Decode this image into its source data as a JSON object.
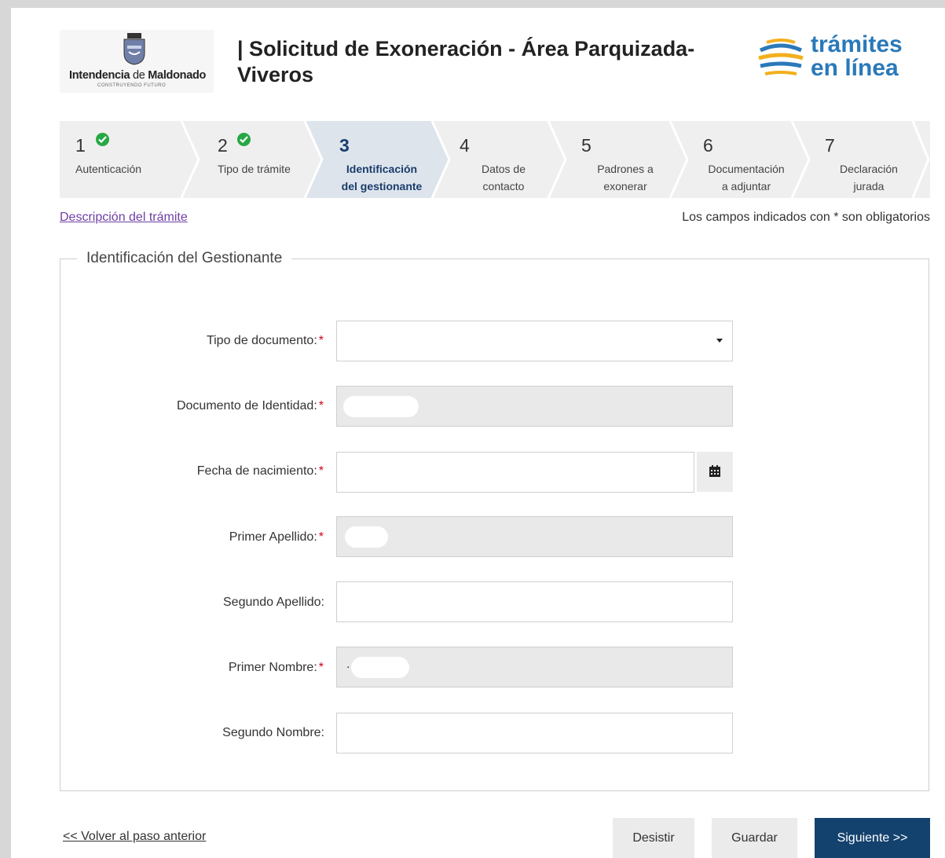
{
  "header": {
    "org_name_bold": "Intendencia",
    "org_name_de": "de",
    "org_name_place": "Maldonado",
    "org_motto": "CONSTRUYENDO FUTURO",
    "title": "| Solicitud de Exoneración - Área Parquizada- Viveros",
    "brand_line1": "trámites",
    "brand_line2": "en línea"
  },
  "stepper": {
    "steps": [
      {
        "number": "1",
        "label": "Autenticación",
        "state": "completed"
      },
      {
        "number": "2",
        "label": "Tipo de trámite",
        "state": "completed"
      },
      {
        "number": "3",
        "label_line1": "Identificación",
        "label_line2": "del gestionante",
        "state": "active"
      },
      {
        "number": "4",
        "label_line1": "Datos de",
        "label_line2": "contacto",
        "state": "pending"
      },
      {
        "number": "5",
        "label_line1": "Padrones a",
        "label_line2": "exonerar",
        "state": "pending"
      },
      {
        "number": "6",
        "label_line1": "Documentación",
        "label_line2": "a adjuntar",
        "state": "pending"
      },
      {
        "number": "7",
        "label_line1": "Declaración",
        "label_line2": "jurada",
        "state": "pending"
      }
    ]
  },
  "links": {
    "description": "Descripción del trámite",
    "required_note": "Los campos indicados con * son obligatorios"
  },
  "form": {
    "legend": "Identificación del Gestionante",
    "required_marker": "*",
    "fields": [
      {
        "label": "Tipo de documento:",
        "required": true,
        "type": "select",
        "value": ""
      },
      {
        "label": "Documento de Identidad:",
        "required": true,
        "type": "text",
        "disabled": true,
        "value": ""
      },
      {
        "label": "Fecha de nacimiento:",
        "required": true,
        "type": "date",
        "value": ""
      },
      {
        "label": "Primer Apellido:",
        "required": true,
        "type": "text",
        "disabled": true,
        "value": ""
      },
      {
        "label": "Segundo Apellido:",
        "required": false,
        "type": "text",
        "value": ""
      },
      {
        "label": "Primer Nombre:",
        "required": true,
        "type": "text",
        "disabled": true,
        "value": "."
      },
      {
        "label": "Segundo Nombre:",
        "required": false,
        "type": "text",
        "value": ""
      }
    ]
  },
  "actions": {
    "back": "<< Volver al paso anterior",
    "desist": "Desistir",
    "save": "Guardar",
    "next": "Siguiente >>"
  },
  "colors": {
    "active_step_bg": "#dde4ec",
    "step_bg": "#efefef",
    "check_green": "#27a844",
    "primary_button": "#14426e",
    "required_star": "#d0021b",
    "link_purple": "#6f3fa6",
    "brand_blue": "#2a79b9"
  },
  "icons": [
    "coat-of-arms-icon",
    "check-circle-icon",
    "chevron-down-icon",
    "calendar-icon",
    "tramites-globe-icon"
  ]
}
